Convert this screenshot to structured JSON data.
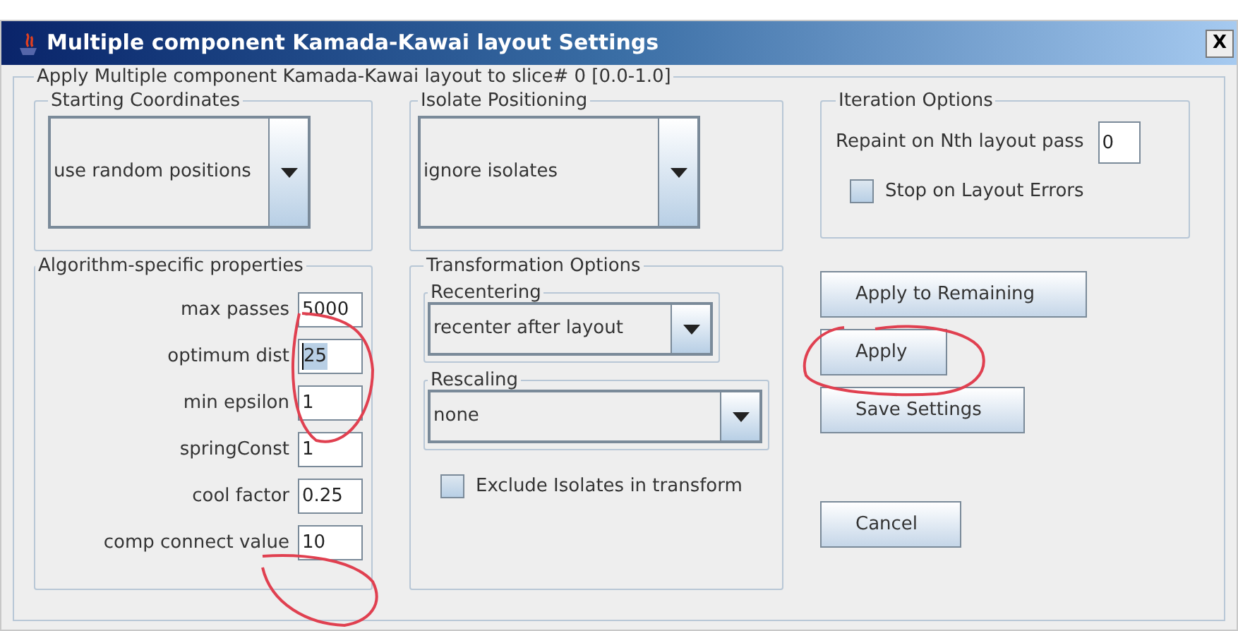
{
  "window": {
    "title": "Multiple component Kamada-Kawai layout Settings",
    "close": "X"
  },
  "panel_title": "Apply Multiple component Kamada-Kawai layout to slice# 0 [0.0-1.0]",
  "starting_coordinates": {
    "title": "Starting Coordinates",
    "value": "use random positions"
  },
  "isolate_positioning": {
    "title": "Isolate Positioning",
    "value": "ignore isolates"
  },
  "iteration_options": {
    "title": "Iteration Options",
    "repaint_label": "Repaint on Nth layout pass",
    "repaint_value": "0",
    "stop_on_errors": {
      "label": "Stop on Layout Errors",
      "checked": false
    }
  },
  "algorithm_properties": {
    "title": "Algorithm-specific properties",
    "fields": [
      {
        "label": "max passes",
        "value": "5000",
        "text_selected": false
      },
      {
        "label": "optimum dist",
        "value": "25",
        "text_selected": true
      },
      {
        "label": "min epsilon",
        "value": "1",
        "text_selected": false
      },
      {
        "label": "springConst",
        "value": "1",
        "text_selected": false
      },
      {
        "label": "cool factor",
        "value": "0.25",
        "text_selected": false
      },
      {
        "label": "comp connect value",
        "value": "10",
        "text_selected": false
      }
    ]
  },
  "transformation_options": {
    "title": "Transformation Options",
    "recentering": {
      "title": "Recentering",
      "value": "recenter after layout"
    },
    "rescaling": {
      "title": "Rescaling",
      "value": "none"
    },
    "exclude_isolates": {
      "label": "Exclude Isolates in transform",
      "checked": false
    }
  },
  "buttons": [
    "Apply to Remaining",
    "Apply",
    "Save Settings",
    "Cancel"
  ]
}
